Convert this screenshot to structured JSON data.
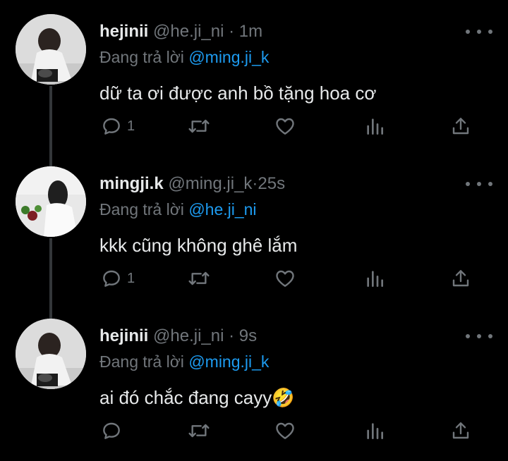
{
  "tweets": [
    {
      "name": "hejinii",
      "handle": "@he.ji_ni",
      "time": "1m",
      "replying_prefix": "Đang trả lời",
      "replying_to": "@ming.ji_k",
      "text": "dữ ta ơi được anh bồ tặng hoa cơ",
      "reply_count": "1"
    },
    {
      "name": "mingji.k",
      "handle": "@ming.ji_k",
      "time": "25s",
      "replying_prefix": "Đang trả lời",
      "replying_to": "@he.ji_ni",
      "text": "kkk cũng không ghê lắm",
      "reply_count": "1"
    },
    {
      "name": "hejinii",
      "handle": "@he.ji_ni",
      "time": "9s",
      "replying_prefix": "Đang trả lời",
      "replying_to": "@ming.ji_k",
      "text": "ai đó chắc đang cayy🤣",
      "reply_count": ""
    }
  ],
  "separator": "·",
  "icons": {
    "more": "more-dots-icon",
    "reply": "reply-bubble-icon",
    "retweet": "retweet-icon",
    "like": "heart-icon",
    "views": "views-bar-icon",
    "share": "share-icon"
  },
  "colors": {
    "background": "#000000",
    "text": "#e7e9ea",
    "muted": "#71767b",
    "mention": "#1d9bf0",
    "thread_line": "#333639"
  }
}
